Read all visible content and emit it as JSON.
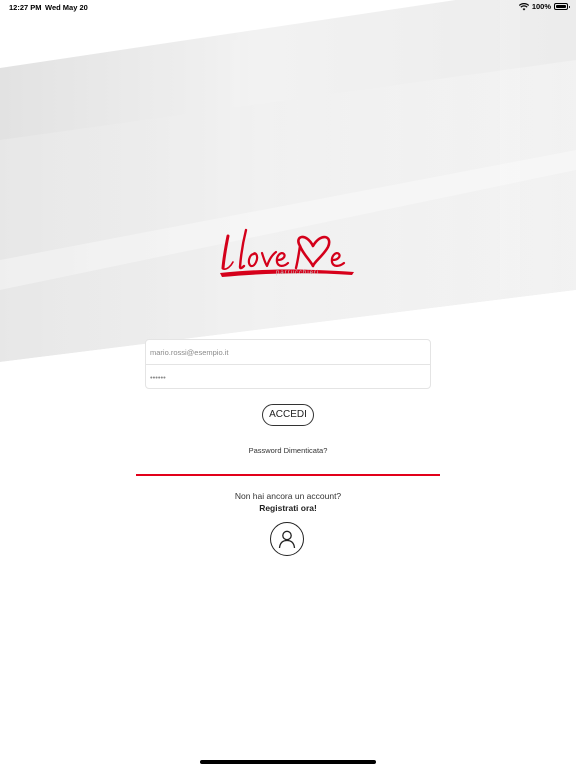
{
  "status_bar": {
    "time": "12:27 PM",
    "date": "Wed May 20",
    "battery_text": "100%",
    "battery_level": 1.0,
    "wifi_icon": "wifi-icon",
    "battery_icon": "battery-icon"
  },
  "brand": {
    "logo_icon": "ilove-me-logo",
    "subtitle": "parrucchieri",
    "accent_color": "#e2001a"
  },
  "login": {
    "email_placeholder": "mario.rossi@esempio.it",
    "password_placeholder": "••••••",
    "submit_label": "ACCEDI",
    "forgot_label": "Password Dimenticata?"
  },
  "register": {
    "prompt": "Non hai ancora un account?",
    "link_label": "Registrati ora!",
    "icon": "user-icon"
  }
}
